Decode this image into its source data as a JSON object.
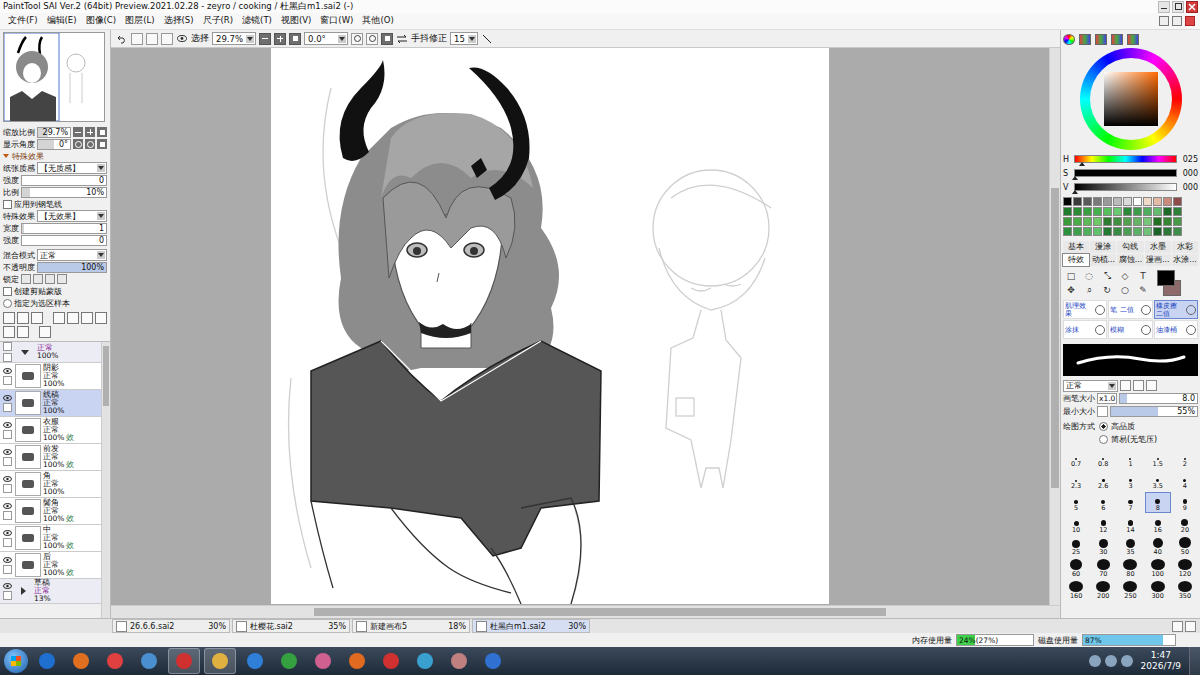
{
  "window": {
    "title": "PaintTool SAI Ver.2 (64bit) Preview.2021.02.28 - zeyro / cooking / 杜黑白m1.sai2 (-)"
  },
  "menu": [
    "文件(F)",
    "编辑(E)",
    "图像(C)",
    "图层(L)",
    "选择(S)",
    "尺子(R)",
    "滤镜(T)",
    "视图(V)",
    "窗口(W)",
    "其他(O)"
  ],
  "toolbar": {
    "select": "选择",
    "zoom": "29.7%",
    "angle": "0.0°",
    "stabilizer_label": "手抖修正",
    "stabilizer": "15"
  },
  "navigator": {
    "zoom_label": "缩放比例",
    "zoom": "29.7%",
    "zoom_level": 0.3,
    "angle_label": "显示角度",
    "angle": "0°",
    "angle_level": 0.5
  },
  "effects": {
    "header": "特殊效果",
    "paper_label": "纸张质感",
    "paper": "【无质感】",
    "strength_label": "强度",
    "strength": "0",
    "strength_level": 0,
    "scale_label": "比例",
    "scale": "10%",
    "scale_level": 0.1,
    "apply_pen": {
      "label": "应用到钢笔线",
      "checked": false
    },
    "effect_label": "特殊效果",
    "effect": "【无效果】",
    "width_label": "宽度",
    "width": "1",
    "width_level": 0.02,
    "effect_strength_label": "强度",
    "effect_strength": "0",
    "effect_strength_level": 0
  },
  "layer_props": {
    "blend_label": "混合模式",
    "blend": "正常",
    "opacity_label": "不透明度",
    "opacity": "100%",
    "opacity_level": 1,
    "lock_label": "锁定",
    "clip": {
      "label": "创建剪贴蒙版",
      "checked": false
    },
    "sample": {
      "label": "指定为选区样本",
      "checked": false
    }
  },
  "layers": [
    {
      "kind": "folder",
      "mode": "正常",
      "opacity": "100%",
      "badge": "",
      "visible": false,
      "selected": false,
      "expanded": true
    },
    {
      "kind": "layer",
      "name": "阴影",
      "mode": "正常",
      "opacity": "100%",
      "badge": "",
      "visible": true,
      "selected": false
    },
    {
      "kind": "layer",
      "name": "线稿",
      "mode": "正常",
      "opacity": "100%",
      "badge": "",
      "visible": true,
      "selected": true
    },
    {
      "kind": "layer",
      "name": "衣服",
      "mode": "正常",
      "opacity": "100%",
      "badge": "效",
      "visible": true,
      "selected": false
    },
    {
      "kind": "layer",
      "name": "前发",
      "mode": "正常",
      "opacity": "100%",
      "badge": "效",
      "visible": true,
      "selected": false
    },
    {
      "kind": "layer",
      "name": "角",
      "mode": "正常",
      "opacity": "100%",
      "badge": "",
      "visible": true,
      "selected": false
    },
    {
      "kind": "layer",
      "name": "鬓角",
      "mode": "正常",
      "opacity": "100%",
      "badge": "效",
      "visible": true,
      "selected": false
    },
    {
      "kind": "layer",
      "name": "中",
      "mode": "正常",
      "opacity": "100%",
      "badge": "效",
      "visible": true,
      "selected": false
    },
    {
      "kind": "layer",
      "name": "后",
      "mode": "正常",
      "opacity": "100%",
      "badge": "效",
      "visible": true,
      "selected": false
    },
    {
      "kind": "folder",
      "name": "草稿",
      "mode": "正常",
      "opacity": "13%",
      "badge": "",
      "visible": true,
      "selected": false,
      "expanded": false
    }
  ],
  "color": {
    "hsv": [
      {
        "label": "H",
        "value": "025",
        "level": 0.07
      },
      {
        "label": "S",
        "value": "000",
        "level": 0
      },
      {
        "label": "V",
        "value": "000",
        "level": 0
      }
    ],
    "primary": "#000000",
    "secondary": "#8e6a6a"
  },
  "swatches": [
    "#000000",
    "#3a3a3a",
    "#5a5a5a",
    "#7a7a7a",
    "#9a9a9a",
    "#bababa",
    "#dadada",
    "#ffffff",
    "#f1d9c8",
    "#e4b9a6",
    "#c98b7c",
    "#8e4b4b",
    "#1f7a2a",
    "#2b8c34",
    "#38a040",
    "#47b04e",
    "#57bf5e",
    "#69c96f",
    "#2a8a3a",
    "#3d9c4a",
    "#50ad5b",
    "#63bc6c",
    "#1c6a26",
    "#2f7f38",
    "#3a9a3a",
    "#4aab48",
    "#5cbb57",
    "#6ec866",
    "#2e7d2e",
    "#409040",
    "#52a252",
    "#65b465",
    "#77c577",
    "#237023",
    "#358535",
    "#489948",
    "#2c8f3c",
    "#3e9f4c",
    "#51b05c",
    "#63c06d",
    "#247a31",
    "#378c43",
    "#4a9e55",
    "#5db067",
    "#70c279",
    "#1a6427",
    "#2d7839",
    "#408c4b"
  ],
  "tool_tabs": [
    {
      "label": "基本",
      "selected": false
    },
    {
      "label": "漫涂",
      "selected": false
    },
    {
      "label": "勾线",
      "selected": false
    },
    {
      "label": "水墨",
      "selected": false
    },
    {
      "label": "水彩",
      "selected": false
    },
    {
      "label": "特效",
      "selected": true
    },
    {
      "label": "动植…",
      "selected": false
    },
    {
      "label": "腐蚀…",
      "selected": false
    },
    {
      "label": "漫画…",
      "selected": false
    },
    {
      "label": "水涂…",
      "selected": false
    }
  ],
  "tools": [
    {
      "glyph": "□",
      "selected": false
    },
    {
      "glyph": "◌",
      "selected": false
    },
    {
      "glyph": "⤡",
      "selected": false
    },
    {
      "glyph": "◇",
      "selected": false
    },
    {
      "glyph": "T",
      "selected": false
    },
    {
      "glyph": "✥",
      "selected": false
    },
    {
      "glyph": "⌕",
      "selected": false
    },
    {
      "glyph": "↻",
      "selected": false
    },
    {
      "glyph": "○",
      "selected": false
    },
    {
      "glyph": "✎",
      "selected": false
    }
  ],
  "brush_tools": [
    {
      "label": "肌理效果",
      "selected": false
    },
    {
      "label": "笔 二值",
      "selected": false
    },
    {
      "label": "橡皮擦 二值",
      "selected": true
    },
    {
      "label": "涂抹",
      "selected": false
    },
    {
      "label": "模糊",
      "selected": false
    },
    {
      "label": "油漆桶",
      "selected": false
    }
  ],
  "brush": {
    "blend": "正常",
    "size_label": "画笔大小",
    "size_factor": "x1.0",
    "size": "8.0",
    "size_level": 0.08,
    "min_label": "最小大小",
    "min": "55%",
    "min_level": 0.55,
    "mode_label": "绘图方式",
    "modes": [
      {
        "label": "高品质",
        "selected": true
      },
      {
        "label": "简易(无笔压)",
        "selected": false
      }
    ]
  },
  "brush_sizes": [
    {
      "value": "0.7",
      "selected": false
    },
    {
      "value": "0.8",
      "selected": false
    },
    {
      "value": "1",
      "selected": false
    },
    {
      "value": "1.5",
      "selected": false
    },
    {
      "value": "2",
      "selected": false
    },
    {
      "value": "2.3",
      "selected": false
    },
    {
      "value": "2.6",
      "selected": false
    },
    {
      "value": "3",
      "selected": false
    },
    {
      "value": "3.5",
      "selected": false
    },
    {
      "value": "4",
      "selected": false
    },
    {
      "value": "5",
      "selected": false
    },
    {
      "value": "6",
      "selected": false
    },
    {
      "value": "7",
      "selected": false
    },
    {
      "value": "8",
      "selected": true
    },
    {
      "value": "9",
      "selected": false
    },
    {
      "value": "10",
      "selected": false
    },
    {
      "value": "12",
      "selected": false
    },
    {
      "value": "14",
      "selected": false
    },
    {
      "value": "16",
      "selected": false
    },
    {
      "value": "20",
      "selected": false
    },
    {
      "value": "25",
      "selected": false
    },
    {
      "value": "30",
      "selected": false
    },
    {
      "value": "35",
      "selected": false
    },
    {
      "value": "40",
      "selected": false
    },
    {
      "value": "50",
      "selected": false
    },
    {
      "value": "60",
      "selected": false
    },
    {
      "value": "70",
      "selected": false
    },
    {
      "value": "80",
      "selected": false
    },
    {
      "value": "100",
      "selected": false
    },
    {
      "value": "120",
      "selected": false
    },
    {
      "value": "160",
      "selected": false
    },
    {
      "value": "200",
      "selected": false
    },
    {
      "value": "250",
      "selected": false
    },
    {
      "value": "300",
      "selected": false
    },
    {
      "value": "350",
      "selected": false
    }
  ],
  "documents": [
    {
      "name": "26.6.6.sai2",
      "zoom": "30%",
      "selected": false
    },
    {
      "name": "杜樱花.sai2",
      "zoom": "35%",
      "selected": false
    },
    {
      "name": "新建画布5",
      "zoom": "18%",
      "selected": false
    },
    {
      "name": "杜黑白m1.sai2",
      "zoom": "30%",
      "selected": true
    }
  ],
  "status": {
    "memory_label": "内存使用量",
    "memory": "24%",
    "memory_peak": "(27%)",
    "memory_level": 0.24,
    "disk_label": "磁盘使用量",
    "disk": "87%",
    "disk_level": 0.87
  },
  "taskbar": {
    "time": "1:47",
    "date": "2026/7/9"
  }
}
